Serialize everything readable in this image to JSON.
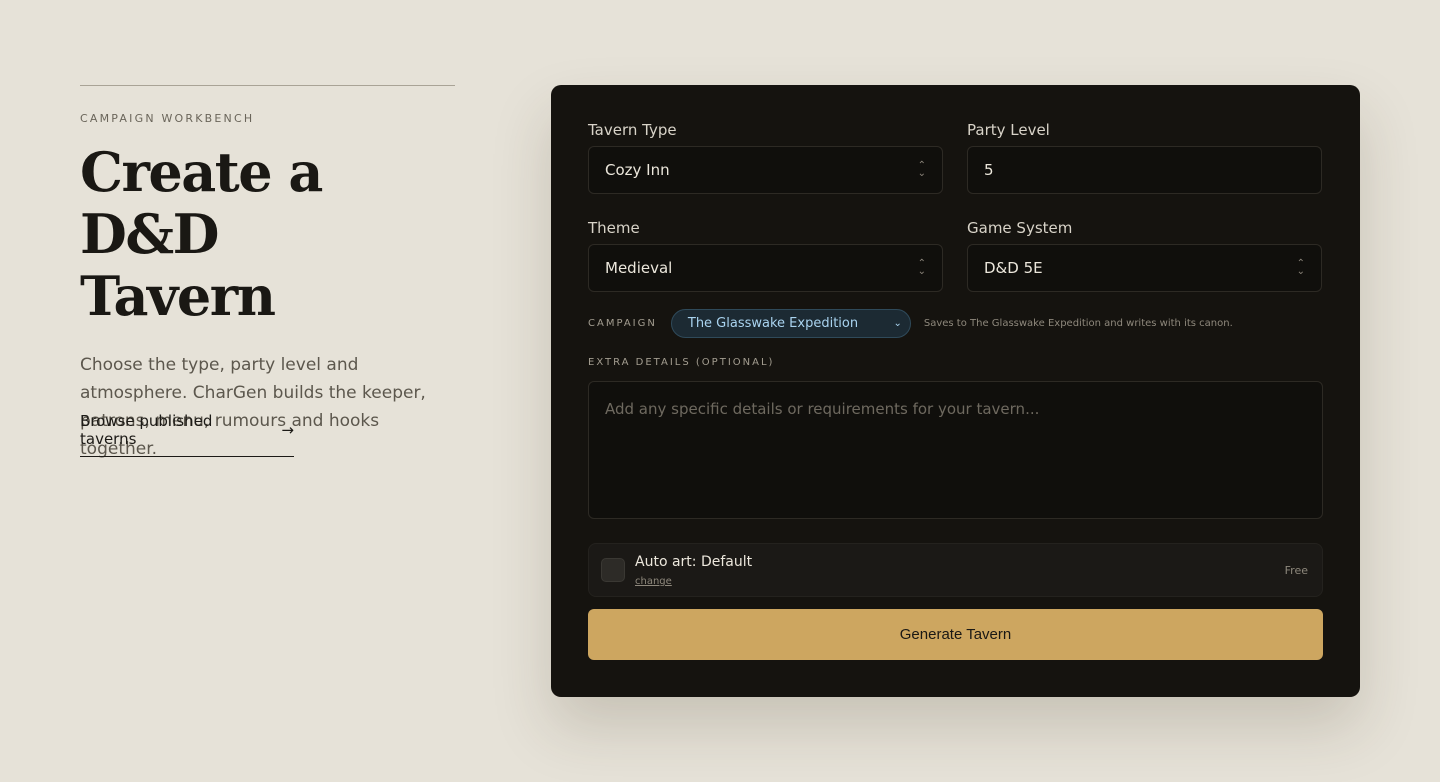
{
  "hero": {
    "eyebrow": "CAMPAIGN WORKBENCH",
    "title_line1": "Create a D&D",
    "title_line2": "Tavern",
    "lede": "Choose the type, party level and atmosphere. CharGen builds the keeper, patrons, menu, rumours and hooks together.",
    "browse_label": "Browse published taverns"
  },
  "form": {
    "tavern_type": {
      "label": "Tavern Type",
      "value": "Cozy Inn"
    },
    "party_level": {
      "label": "Party Level",
      "value": "5"
    },
    "theme": {
      "label": "Theme",
      "value": "Medieval"
    },
    "game_system": {
      "label": "Game System",
      "value": "D&D 5E"
    },
    "campaign": {
      "label": "CAMPAIGN",
      "value": "The Glasswake Expedition",
      "note": "Saves to The Glasswake Expedition and writes with its canon."
    },
    "extra_details": {
      "label": "EXTRA DETAILS (OPTIONAL)",
      "placeholder": "Add any specific details or requirements for your tavern..."
    },
    "auto_art": {
      "title": "Auto art: Default",
      "change_label": "change",
      "price": "Free"
    },
    "generate_label": "Generate Tavern"
  },
  "icons": {
    "select": "chevron-up-down-icon",
    "campaign": "chevron-down-icon",
    "browse": "arrow-right-icon"
  },
  "colors": {
    "page_bg": "#e6e2d8",
    "card_bg": "#15130f",
    "accent": "#cda660",
    "campaign_text": "#a9d3ef"
  }
}
